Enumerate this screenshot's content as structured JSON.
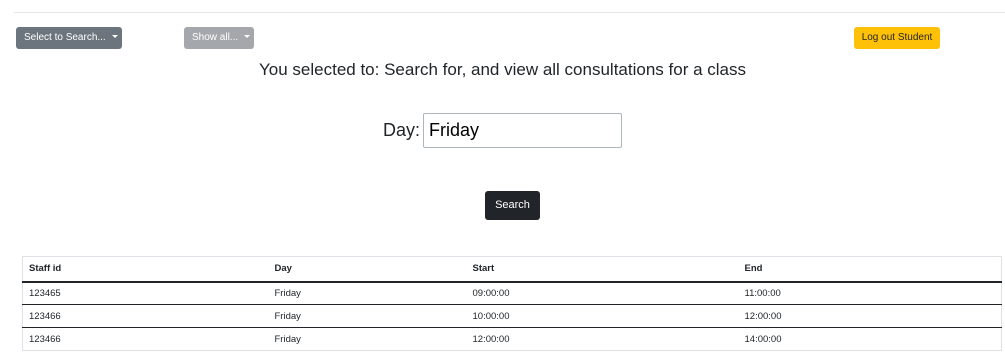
{
  "toolbar": {
    "select_label": "Select to Search...",
    "show_all_label": "Show all...",
    "logout_label": "Log out Student"
  },
  "heading": "You selected to: Search for, and view all consultations for a class",
  "search": {
    "day_label": "Day:",
    "day_value": "Friday",
    "button_label": "Search"
  },
  "table": {
    "headers": [
      "Staff id",
      "Day",
      "Start",
      "End"
    ],
    "rows": [
      [
        "123465",
        "Friday",
        "09:00:00",
        "11:00:00"
      ],
      [
        "123466",
        "Friday",
        "10:00:00",
        "12:00:00"
      ],
      [
        "123466",
        "Friday",
        "12:00:00",
        "14:00:00"
      ]
    ]
  },
  "colors": {
    "secondary": "#6c757d",
    "secondary_disabled": "#a4a8ac",
    "warning": "#ffc107",
    "dark": "#212529"
  }
}
